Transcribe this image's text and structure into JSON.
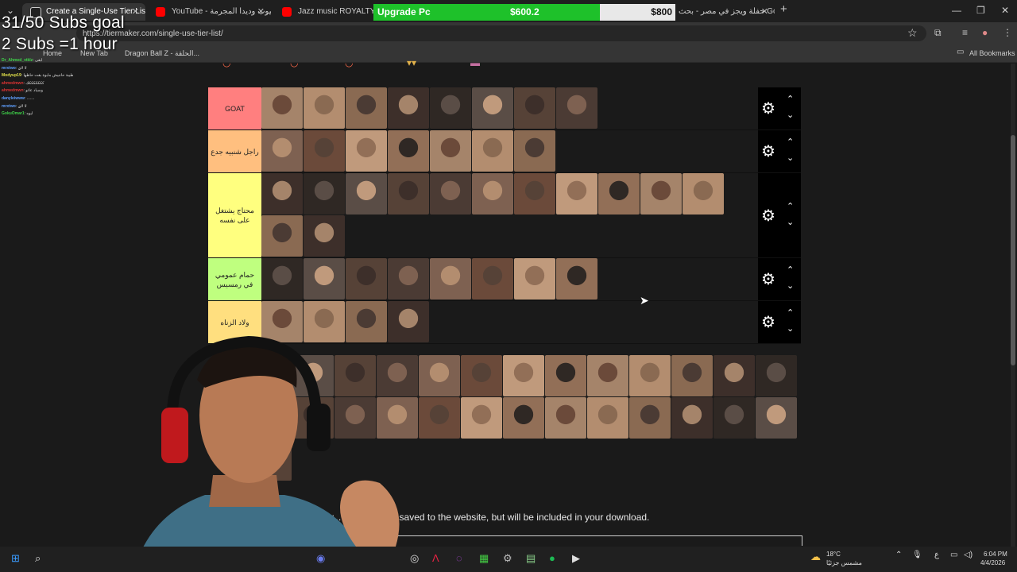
{
  "tabs": [
    {
      "label": "Create a Single-Use Tier List (f...",
      "active": true
    },
    {
      "label": "YouTube - إيستيوب وديدا المجرمة",
      "active": false
    },
    {
      "label": "Jazz music ROYALTY FREE Bac...",
      "active": false
    },
    {
      "label": "حفلة ويجز في مصر - بحث Google",
      "active": false
    }
  ],
  "upgrade": {
    "label": "Upgrade Pc",
    "current": "$600.2",
    "target": "$800",
    "progress": 0.75
  },
  "url": "https://tiermaker.com/single-use-tier-list/",
  "bookmarks": [
    "Home",
    "New Tab",
    "Dragon Ball Z - الحلقة...",
    "All Bookmarks"
  ],
  "overlay": {
    "line1": "31/50 Subs goal",
    "line2": "2 Subs =1 hour"
  },
  "chat": [
    {
      "user": "Dr_Ahmed_vtklz",
      "msg": ": ابقى"
    },
    {
      "user": "mrxtwo",
      "msg": ": لا لاي"
    },
    {
      "user": "Modyup19",
      "msg": ": طيبة حاجيش مابوة بقت حاظها"
    },
    {
      "user": "ahmedmwn",
      "msg": ": كككككككك"
    },
    {
      "user": "ahmedmwn",
      "msg": ": وسياد عاتو"
    },
    {
      "user": "danyleiwww",
      "msg": ": ......."
    },
    {
      "user": "mrxtwo",
      "msg": ": لا لاي"
    },
    {
      "user": "GokuOmar1",
      "msg": ": ايوه"
    }
  ],
  "tiers": [
    {
      "label": "GOAT",
      "color": "#ff7f7f",
      "count": 8
    },
    {
      "label": "راجل شنبيه جدع",
      "color": "#ffbf7f",
      "count": 7
    },
    {
      "label": "محتاج يشتغل على نفسه",
      "color": "#ffff7f",
      "count": 13
    },
    {
      "label": "حمام عمومي في رمسيس",
      "color": "#bfff7f",
      "count": 8
    },
    {
      "label": "ولاد الزناه",
      "color": "#ffdf7f",
      "count": 4
    }
  ],
  "pool_count": 27,
  "note": "e used in y... ages are not saved to the website, but will be included in your download.",
  "taskbar": {
    "weather": "18°C",
    "weather_desc": "مشمس جزئيًا",
    "time": "6:04 PM",
    "date": "4/4/2026",
    "lang": "ع"
  }
}
